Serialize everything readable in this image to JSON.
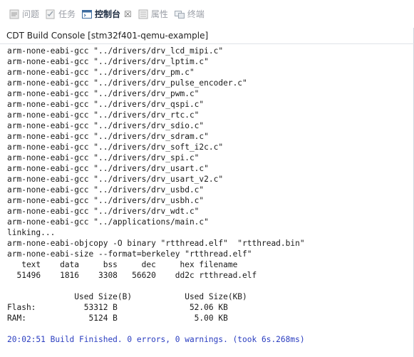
{
  "tabs": [
    {
      "label": "问题",
      "icon": "problems-icon",
      "active": false
    },
    {
      "label": "任务",
      "icon": "tasks-icon",
      "active": false
    },
    {
      "label": "控制台",
      "icon": "console-icon",
      "active": true,
      "close": "☒"
    },
    {
      "label": "属性",
      "icon": "properties-icon",
      "active": false
    },
    {
      "label": "终端",
      "icon": "terminal-icon",
      "active": false
    }
  ],
  "console": {
    "title": "CDT Build Console [stm32f401-qemu-example]",
    "lines": [
      "arm-none-eabi-gcc \"../drivers/drv_lcd_mipi.c\"",
      "arm-none-eabi-gcc \"../drivers/drv_lptim.c\"",
      "arm-none-eabi-gcc \"../drivers/drv_pm.c\"",
      "arm-none-eabi-gcc \"../drivers/drv_pulse_encoder.c\"",
      "arm-none-eabi-gcc \"../drivers/drv_pwm.c\"",
      "arm-none-eabi-gcc \"../drivers/drv_qspi.c\"",
      "arm-none-eabi-gcc \"../drivers/drv_rtc.c\"",
      "arm-none-eabi-gcc \"../drivers/drv_sdio.c\"",
      "arm-none-eabi-gcc \"../drivers/drv_sdram.c\"",
      "arm-none-eabi-gcc \"../drivers/drv_soft_i2c.c\"",
      "arm-none-eabi-gcc \"../drivers/drv_spi.c\"",
      "arm-none-eabi-gcc \"../drivers/drv_usart.c\"",
      "arm-none-eabi-gcc \"../drivers/drv_usart_v2.c\"",
      "arm-none-eabi-gcc \"../drivers/drv_usbd.c\"",
      "arm-none-eabi-gcc \"../drivers/drv_usbh.c\"",
      "arm-none-eabi-gcc \"../drivers/drv_wdt.c\"",
      "arm-none-eabi-gcc \"../applications/main.c\"",
      "linking...",
      "arm-none-eabi-objcopy -O binary \"rtthread.elf\"  \"rtthread.bin\"",
      "arm-none-eabi-size --format=berkeley \"rtthread.elf\"",
      "   text    data     bss     dec     hex filename",
      "  51496    1816    3308   56620    dd2c rtthread.elf",
      "",
      "              Used Size(B)           Used Size(KB)",
      "Flash:          53312 B               52.06 KB",
      "RAM:             5124 B                5.00 KB",
      ""
    ],
    "finished": "20:02:51 Build Finished. 0 errors, 0 warnings. (took 6s.268ms)"
  }
}
